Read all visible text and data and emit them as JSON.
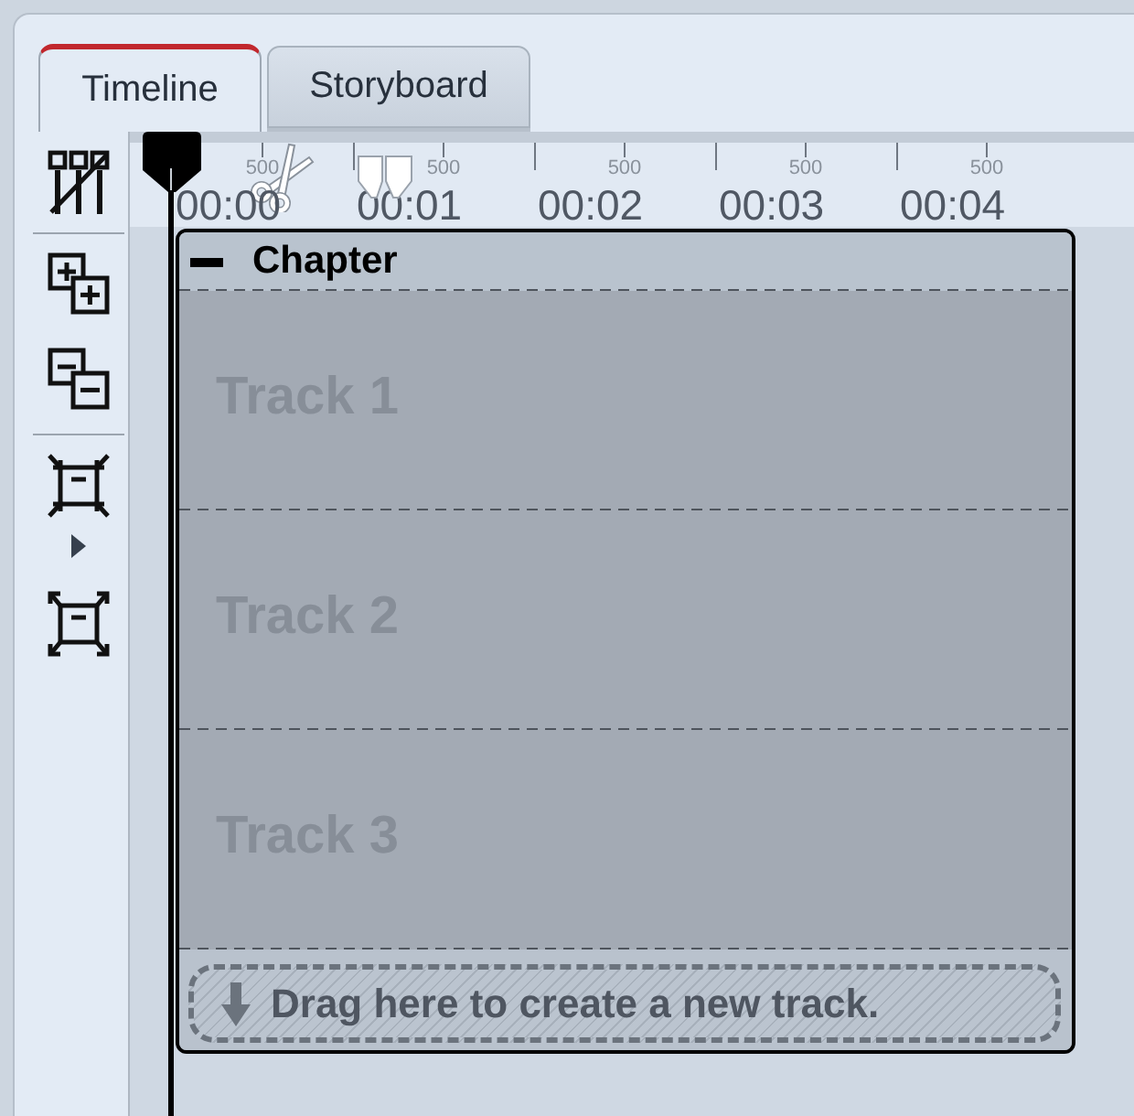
{
  "tabs": [
    {
      "label": "Timeline",
      "selected": true
    },
    {
      "label": "Storyboard",
      "selected": false
    }
  ],
  "ruler": {
    "segments": [
      {
        "label": "00:00",
        "half_label": "500"
      },
      {
        "label": "00:01",
        "half_label": "500"
      },
      {
        "label": "00:02",
        "half_label": "500"
      },
      {
        "label": "00:03",
        "half_label": "500"
      },
      {
        "label": "00:04",
        "half_label": "500"
      }
    ]
  },
  "chapter": {
    "title": "Chapter",
    "expanded": true,
    "tracks": [
      {
        "name": "Track 1"
      },
      {
        "name": "Track 2"
      },
      {
        "name": "Track 3"
      }
    ],
    "drop_hint": "Drag here to create a new track."
  }
}
